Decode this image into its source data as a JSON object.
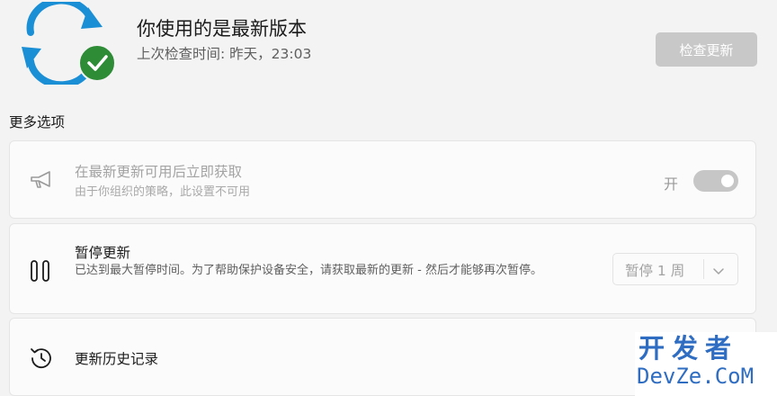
{
  "header": {
    "title": "你使用的是最新版本",
    "last_checked": "上次检查时间: 昨天，23:03",
    "check_button": "检查更新"
  },
  "more_options": {
    "title": "更多选项",
    "items": [
      {
        "label": "在最新更新可用后立即获取",
        "description": "由于你组织的策略，此设置不可用",
        "toggle_text": "开",
        "toggle_on": true,
        "disabled": true,
        "icon": "megaphone-icon"
      },
      {
        "label": "暂停更新",
        "description": "已达到最大暂停时间。为了帮助保护设备安全，请获取最新的更新 - 然后才能够再次暂停。",
        "dropdown_value": "暂停 1 周",
        "icon": "pause-icon"
      },
      {
        "label": "更新历史记录",
        "icon": "history-icon"
      }
    ]
  },
  "watermark": {
    "top": "开发者",
    "bottom": "DevZe.CoM"
  },
  "colors": {
    "sync_blue": "#1a8fd6",
    "check_green": "#2e8b36",
    "watermark_blue": "#2f6dc2"
  }
}
